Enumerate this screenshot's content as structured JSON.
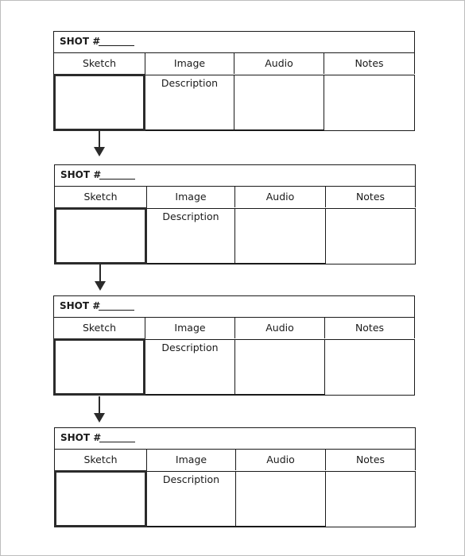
{
  "document": {
    "type": "storyboard-template",
    "shots": [
      {
        "shot_label": "SHOT #",
        "shot_number": "",
        "columns": [
          "Sketch",
          "Image Description",
          "Audio",
          "Notes"
        ]
      },
      {
        "shot_label": "SHOT #",
        "shot_number": "",
        "columns": [
          "Sketch",
          "Image Description",
          "Audio",
          "Notes"
        ]
      },
      {
        "shot_label": "SHOT #",
        "shot_number": "",
        "columns": [
          "Sketch",
          "Image Description",
          "Audio",
          "Notes"
        ]
      },
      {
        "shot_label": "SHOT #",
        "shot_number": "",
        "columns": [
          "Sketch",
          "Image Description",
          "Audio",
          "Notes"
        ]
      }
    ],
    "connectors": [
      "arrow-down-icon",
      "arrow-down-icon",
      "arrow-down-icon"
    ]
  }
}
